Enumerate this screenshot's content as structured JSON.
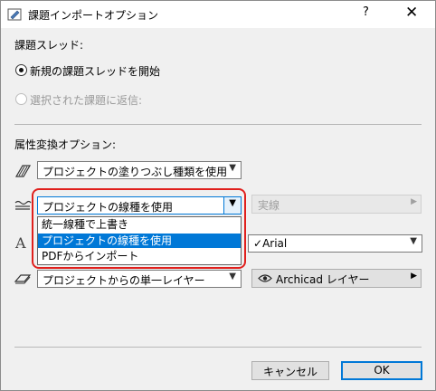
{
  "window": {
    "title": "課題インポートオプション",
    "help_glyph": "?",
    "close_glyph": "✕"
  },
  "thread_section": {
    "label": "課題スレッド:",
    "options": [
      {
        "label": "新規の課題スレッドを開始",
        "selected": true,
        "enabled": true
      },
      {
        "label": "選択された課題に返信:",
        "selected": false,
        "enabled": false
      }
    ]
  },
  "attr_section": {
    "label": "属性変換オプション:",
    "fill": {
      "icon": "fill-pattern-icon",
      "value": "プロジェクトの塗りつぶし種類を使用"
    },
    "line": {
      "icon": "line-type-icon",
      "value": "プロジェクトの線種を使用",
      "side_button": "実線",
      "side_button_enabled": false,
      "options": [
        "統一線種で上書き",
        "プロジェクトの線種を使用",
        "PDFからインポート"
      ],
      "selected_index": 1
    },
    "font": {
      "icon": "font-icon",
      "value": "Arial",
      "check_glyph": "✓"
    },
    "layer": {
      "icon": "layer-icon",
      "value": "プロジェクトからの単一レイヤー",
      "side_button": "Archicad レイヤー",
      "side_button_icon": "eye-icon"
    }
  },
  "footer": {
    "cancel_label": "キャンセル",
    "ok_label": "OK"
  },
  "colors": {
    "highlight": "#0078d7",
    "annotation_frame": "#e0201d"
  }
}
